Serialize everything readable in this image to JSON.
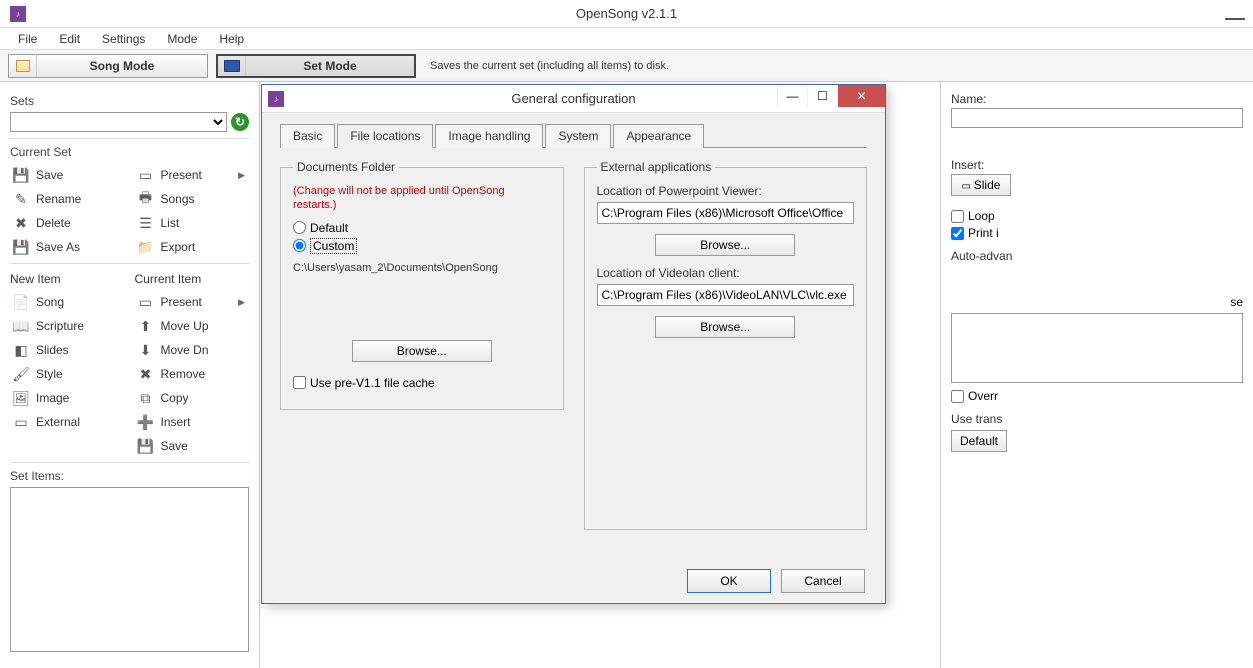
{
  "titlebar": {
    "title": "OpenSong v2.1.1"
  },
  "menu": {
    "file": "File",
    "edit": "Edit",
    "settings": "Settings",
    "mode": "Mode",
    "help": "Help"
  },
  "toolbar": {
    "song_mode": "Song Mode",
    "set_mode": "Set Mode",
    "hint": "Saves the current set (including all items) to disk."
  },
  "sidebar": {
    "sets_label": "Sets",
    "current_set_label": "Current Set",
    "left_items": [
      "Save",
      "Rename",
      "Delete",
      "Save As"
    ],
    "right_items": [
      "Present",
      "Songs",
      "List",
      "Export"
    ],
    "new_item_label": "New Item",
    "new_items": [
      "Song",
      "Scripture",
      "Slides",
      "Style",
      "Image",
      "External"
    ],
    "current_item_label": "Current Item",
    "current_items": [
      "Present",
      "Move Up",
      "Move Dn",
      "Remove",
      "Copy",
      "Insert",
      "Save"
    ],
    "set_items_label": "Set Items:"
  },
  "rightpanel": {
    "name_label": "Name:",
    "insert_label": "Insert:",
    "slide_btn": "Slide",
    "loop": "Loop",
    "print": "Print i",
    "auto_adv": "Auto-advan",
    "se": "se",
    "overr": "Overr",
    "use_trans": "Use trans",
    "default": "Default"
  },
  "dialog": {
    "title": "General configuration",
    "tabs": {
      "basic": "Basic",
      "file_locations": "File locations",
      "image_handling": "Image handling",
      "system": "System",
      "appearance": "Appearance"
    },
    "docs_folder": {
      "legend": "Documents Folder",
      "warn": "(Change will not be applied until OpenSong restarts.)",
      "default": "Default",
      "custom": "Custom",
      "path": "C:\\Users\\yasam_2\\Documents\\OpenSong",
      "browse": "Browse...",
      "cache_cb": "Use pre-V1.1 file cache"
    },
    "ext_apps": {
      "legend": "External applications",
      "ppt_label": "Location of Powerpoint Viewer:",
      "ppt_path": "C:\\Program Files (x86)\\Microsoft Office\\Office",
      "browse": "Browse...",
      "vlc_label": "Location of Videolan client:",
      "vlc_path": "C:\\Program Files (x86)\\VideoLAN\\VLC\\vlc.exe"
    },
    "ok": "OK",
    "cancel": "Cancel"
  }
}
